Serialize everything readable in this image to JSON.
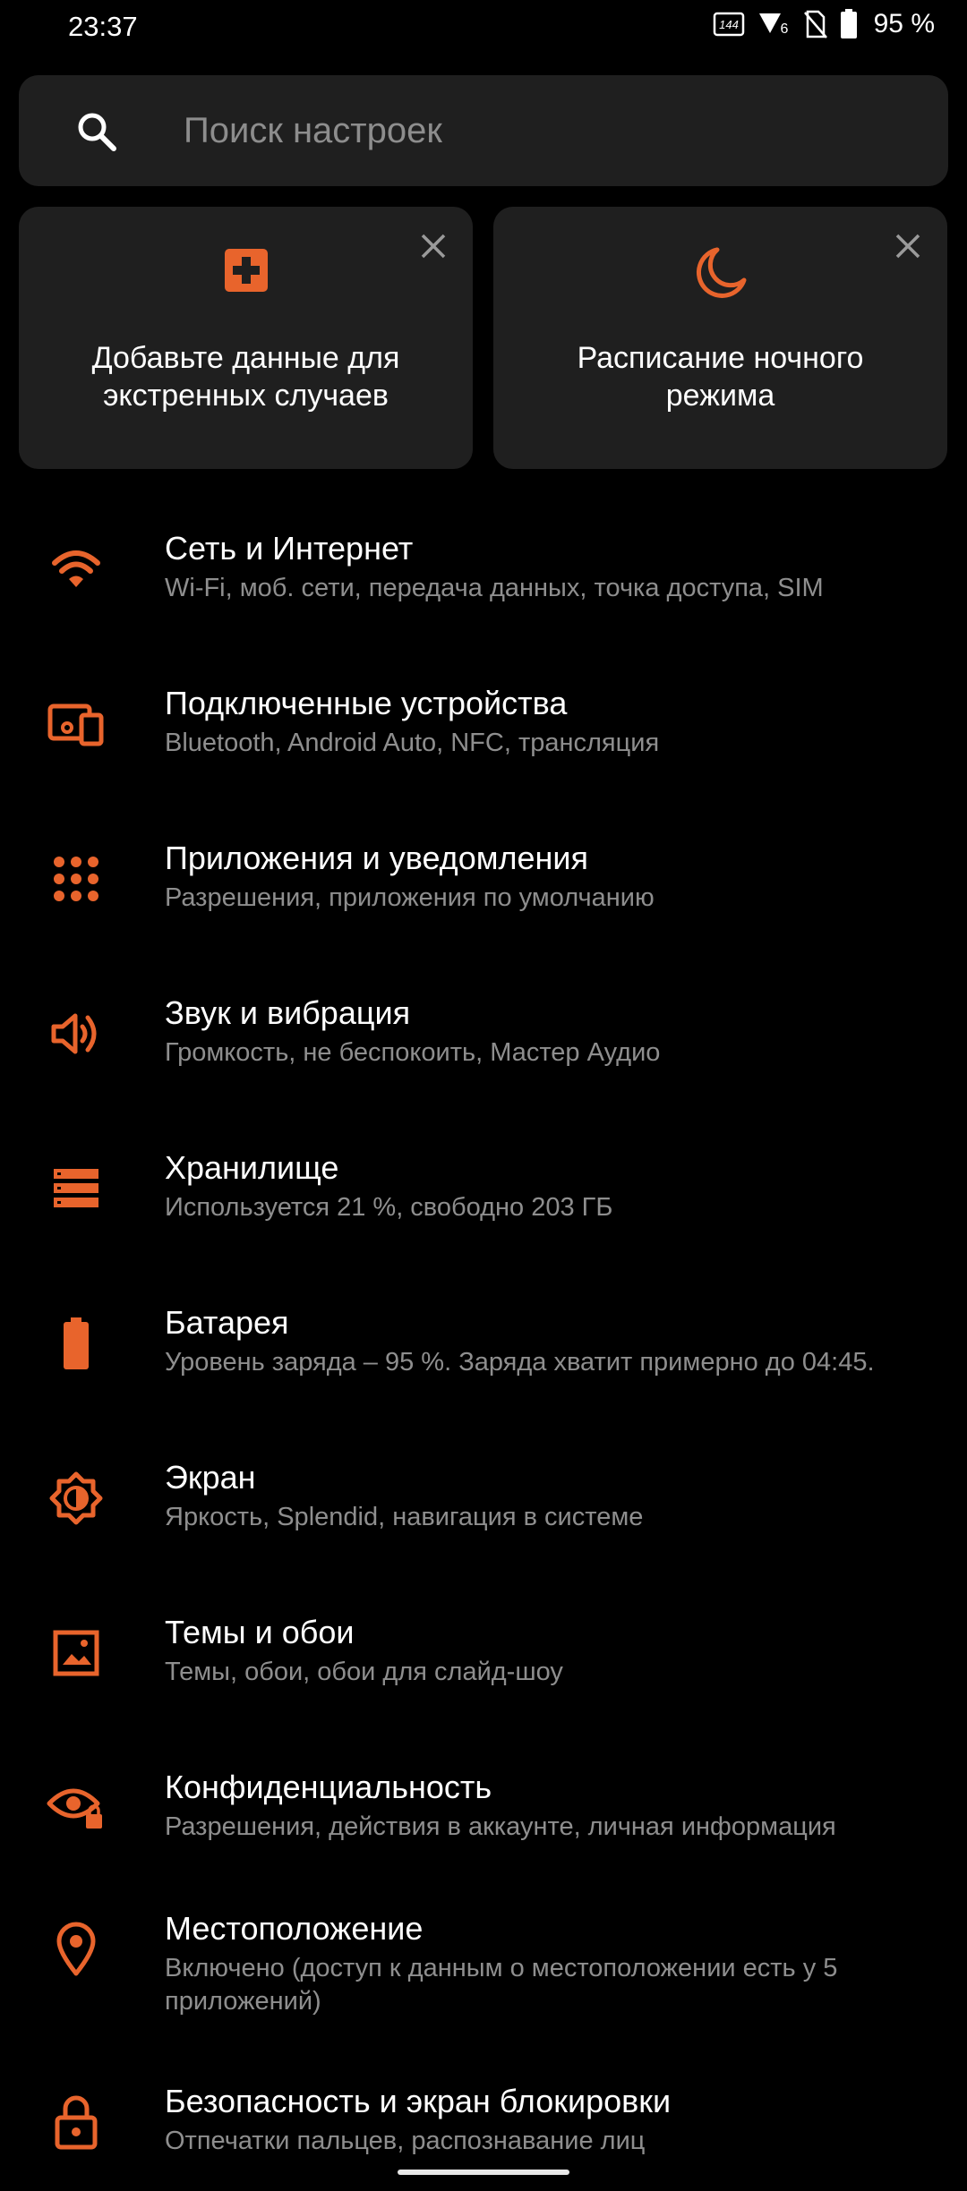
{
  "status_bar": {
    "time": "23:37",
    "battery": "95 %",
    "refresh_badge": "144",
    "signal_badge": "6",
    "icons": [
      "refresh-rate-icon",
      "signal-icon",
      "no-sim-icon",
      "battery-icon"
    ]
  },
  "search": {
    "placeholder": "Поиск настроек"
  },
  "cards": [
    {
      "text": "Добавьте данные для\nэкстренных случаев",
      "icon": "medical-cross-icon"
    },
    {
      "text": "Расписание ночного\nрежима",
      "icon": "moon-icon"
    }
  ],
  "settings": [
    {
      "title": "Сеть и Интернет",
      "subtitle": "Wi-Fi, моб. сети, передача данных, точка доступа, SIM",
      "icon": "wifi-icon"
    },
    {
      "title": "Подключенные устройства",
      "subtitle": "Bluetooth, Android Auto, NFC, трансляция",
      "icon": "devices-icon"
    },
    {
      "title": "Приложения и уведомления",
      "subtitle": "Разрешения, приложения по умолчанию",
      "icon": "apps-grid-icon"
    },
    {
      "title": "Звук и вибрация",
      "subtitle": "Громкость, не беспокоить, Мастер Аудио",
      "icon": "volume-icon"
    },
    {
      "title": "Хранилище",
      "subtitle": "Используется 21 %, свободно 203 ГБ",
      "icon": "storage-icon"
    },
    {
      "title": "Батарея",
      "subtitle": "Уровень заряда – 95 %. Заряда хватит примерно до 04:45.",
      "icon": "battery-icon"
    },
    {
      "title": "Экран",
      "subtitle": "Яркость, Splendid, навигация в системе",
      "icon": "brightness-icon"
    },
    {
      "title": "Темы и обои",
      "subtitle": "Темы, обои, обои для слайд-шоу",
      "icon": "wallpaper-icon"
    },
    {
      "title": "Конфиденциальность",
      "subtitle": "Разрешения, действия в аккаунте, личная информация",
      "icon": "privacy-eye-icon"
    },
    {
      "title": "Местоположение",
      "subtitle": "Включено (доступ к данным о местоположении есть у 5 приложений)",
      "icon": "location-pin-icon"
    },
    {
      "title": "Безопасность и экран блокировки",
      "subtitle": "Отпечатки пальцев, распознавание лиц",
      "icon": "lock-icon"
    }
  ],
  "colors": {
    "accent": "#e8642c",
    "card_bg": "#1f1f1f",
    "subtitle": "#8e8e8e"
  }
}
